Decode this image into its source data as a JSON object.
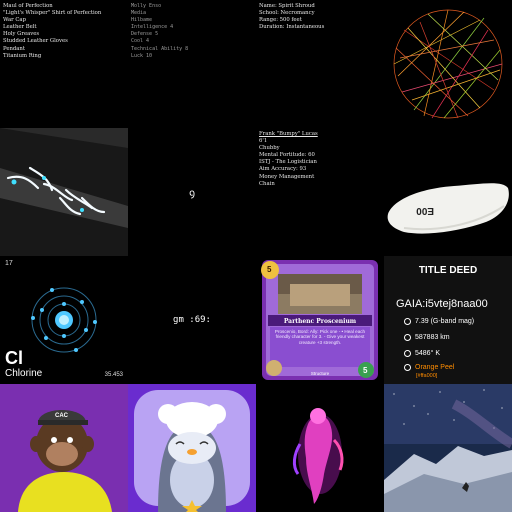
{
  "tiles": {
    "items_list": {
      "lines": [
        "Maul of Perfection",
        "\"Light's Whisper\" Shirt of Perfection",
        "War Cap",
        "Leather Belt",
        "Holy Greaves",
        "Studded Leather Gloves",
        "Pendant",
        "Titanium Ring"
      ]
    },
    "stats": {
      "lines": [
        "Molly Enso",
        "Media",
        "Hilbame",
        "Intelligence 4",
        "Defense 5",
        "Cool 4",
        "Technical Ability 8",
        "Luck 10"
      ]
    },
    "spell": {
      "lines": [
        "Name: Spirit Shroud",
        "School: Necromancy",
        "Range: 500 feet",
        "Duration: Instantaneous"
      ]
    },
    "character": {
      "name": "Frank \"Bumpy\" Lucas",
      "lines": [
        "6'1",
        "Chubby",
        "Mental Fortitude: 60",
        "ISTJ - The Logistician",
        "Aim Accuracy: 93",
        "Money Management",
        "Chain"
      ]
    },
    "glyph": {
      "text": "ꝯ"
    },
    "cap_label": {
      "text": "E00"
    },
    "element": {
      "number": "17",
      "symbol": "Cl",
      "name": "Chlorine",
      "mass": "35.453"
    },
    "gm": {
      "text": "gm :69:"
    },
    "card": {
      "name": "Parthenc Proscenium",
      "text": "Proscenio, Bord: Ally: Pick one - • Heal each friendly character for 3. - Give your weakest creature +3 strength.",
      "type": "Structure",
      "cost": "5",
      "power": "5"
    },
    "deed": {
      "title": "TITLE DEED",
      "name": "GAIA:i5vtej8naa00",
      "mag": "7.39 (G-band mag)",
      "distance": "587883 km",
      "temp": "5486° K",
      "color_name": "Orange Peel",
      "color_hex": "[#ffa000]"
    }
  },
  "colors": {
    "orange": "#ff8c00",
    "purple": "#6a2ccf",
    "lavender": "#b9a3f3"
  }
}
